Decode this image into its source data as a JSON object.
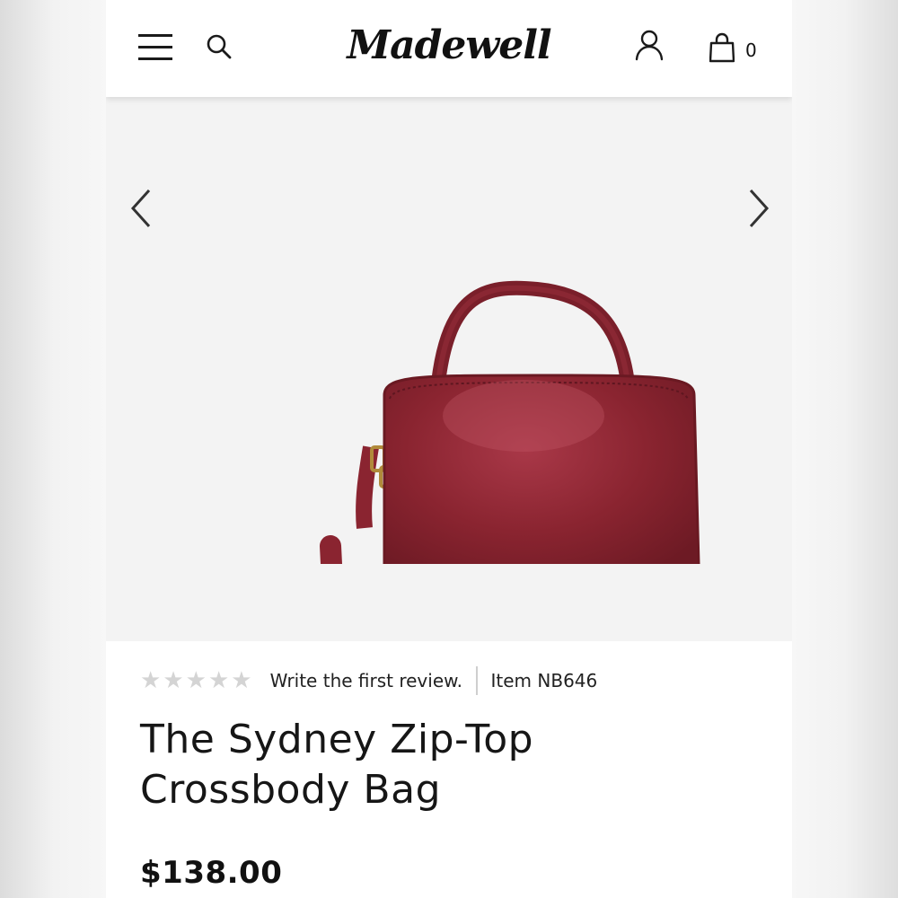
{
  "header": {
    "logo_text": "Madewell",
    "cart_count": "0",
    "icons": [
      "hamburger-menu-icon",
      "search-icon",
      "account-icon",
      "shopping-bag-icon"
    ]
  },
  "gallery": {
    "image_alt": "The Sydney Zip-Top Crossbody Bag in burgundy leather",
    "bag_color": "#8a2430",
    "hardware_color": "#b08a3a"
  },
  "product": {
    "rating_stars": 0,
    "rating_max": 5,
    "review_link": "Write the first review.",
    "item_number": "Item NB646",
    "title": "The Sydney Zip-Top Crossbody Bag",
    "price": "$138.00"
  }
}
